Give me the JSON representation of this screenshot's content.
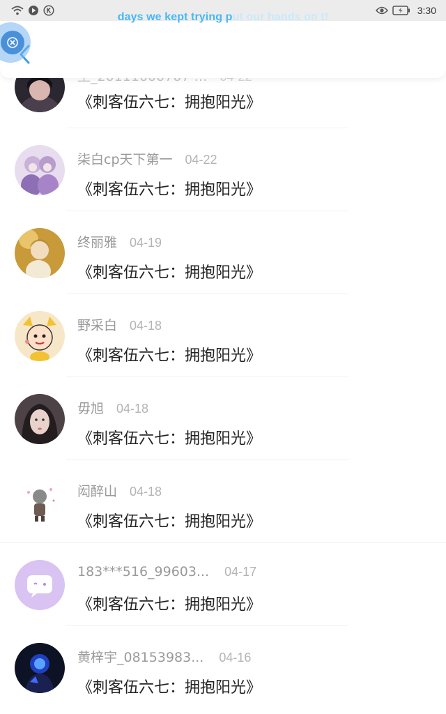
{
  "status_bar": {
    "time": "3:30",
    "left_icons": [
      "wifi-icon",
      "play-circle-icon",
      "k-circle-icon"
    ],
    "right_icons": [
      "eye-icon",
      "battery-charging-icon"
    ]
  },
  "lyric_overlay": {
    "text_bright": "days we kept trying p",
    "text_faded": "ut our hands on t!"
  },
  "header": {
    "back_icon": "chevron-left-icon"
  },
  "comments": [
    {
      "username": "王_20111000707 …",
      "date": "04-22",
      "title": "《刺客伍六七：拥抱阳光》"
    },
    {
      "username": "柒白cp天下第一",
      "date": "04-22",
      "title": "《刺客伍六七：拥抱阳光》"
    },
    {
      "username": "终丽雅",
      "date": "04-19",
      "title": "《刺客伍六七：拥抱阳光》"
    },
    {
      "username": "野采白",
      "date": "04-18",
      "title": "《刺客伍六七：拥抱阳光》"
    },
    {
      "username": "毋旭",
      "date": "04-18",
      "title": "《刺客伍六七：拥抱阳光》"
    },
    {
      "username": "闳醉山",
      "date": "04-18",
      "title": "《刺客伍六七：拥抱阳光》"
    },
    {
      "username": "183***516_99603...",
      "date": "04-17",
      "title": "《刺客伍六七：拥抱阳光》"
    },
    {
      "username": "黄梓宇_08153983...",
      "date": "04-16",
      "title": "《刺客伍六七：拥抱阳光》"
    }
  ],
  "colors": {
    "accent": "#47b8f5",
    "username": "#9a9a9a",
    "date": "#b4b4b4",
    "title": "#222222"
  }
}
